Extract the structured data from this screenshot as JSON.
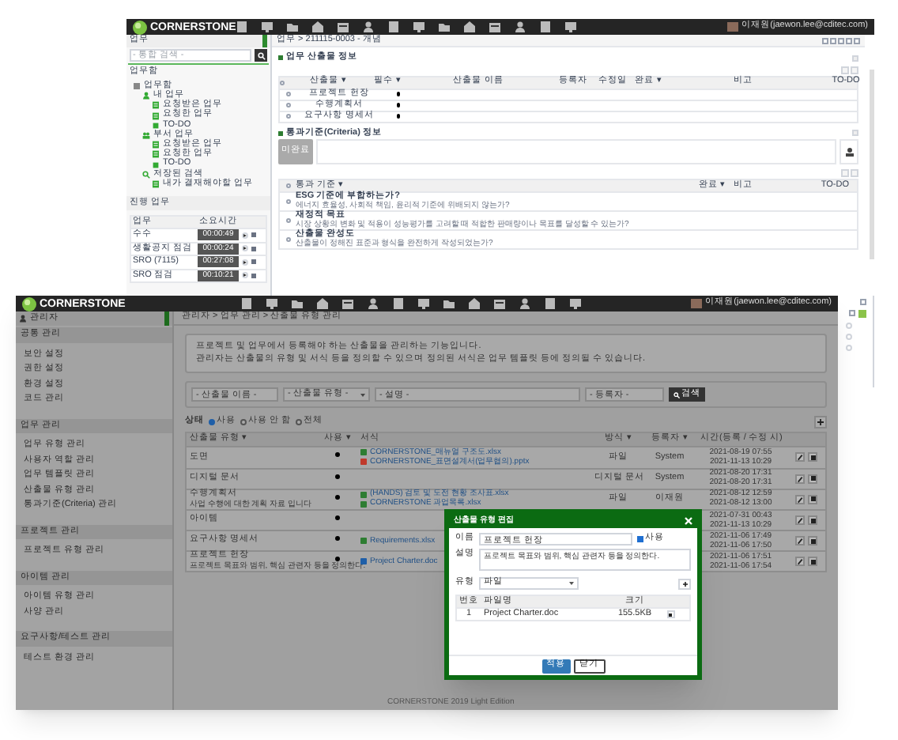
{
  "back_window": {
    "logo": "CORNERSTONE",
    "user": "이재원(jaewon.lee@cditec.com)",
    "sidebar": {
      "title": "업무",
      "search_placeholder": "- 통합 검색 -",
      "section_title": "업무함",
      "tree": [
        {
          "label": "업무함",
          "kind": "root",
          "children": [
            {
              "label": "내 업무",
              "kind": "person",
              "children": [
                {
                  "label": "요청받은 업무",
                  "kind": "list"
                },
                {
                  "label": "요청한 업무",
                  "kind": "list"
                },
                {
                  "label": "TO-DO",
                  "kind": "todo"
                }
              ]
            },
            {
              "label": "부서 업무",
              "kind": "group",
              "children": [
                {
                  "label": "요청받은 업무",
                  "kind": "list"
                },
                {
                  "label": "요청한 업무",
                  "kind": "list"
                },
                {
                  "label": "TO-DO",
                  "kind": "todo"
                }
              ]
            },
            {
              "label": "저장된 검색",
              "kind": "search",
              "children": [
                {
                  "label": "내가 결재해야할 업무",
                  "kind": "list"
                }
              ]
            }
          ]
        }
      ],
      "progress_title": "진행 업무",
      "progress_columns": [
        "업무",
        "소요시간"
      ],
      "progress_rows": [
        {
          "task": "수수",
          "time": "00:00:49"
        },
        {
          "task": "생활공지 점검",
          "time": "00:00:24"
        },
        {
          "task": "SRO (7115)",
          "time": "00:27:08"
        },
        {
          "task": "SRO 점검",
          "time": "00:10:21"
        }
      ]
    },
    "breadcrumb": "업무 > 211115-0003 - 개념",
    "deliverables": {
      "title": "업무 산출물 정보",
      "all_checked": false,
      "columns": [
        "산출물 ▾",
        "필수 ▾",
        "산출물 이름",
        "등록자",
        "수정일",
        "완료 ▾",
        "비고",
        "TO-DO"
      ],
      "rows": [
        {
          "type": "프로젝트 헌장",
          "required": true,
          "checked": false
        },
        {
          "type": "수행계획서",
          "required": true,
          "checked": false
        },
        {
          "type": "요구사항 명세서",
          "required": true,
          "checked": false
        }
      ]
    },
    "criteria": {
      "title": "통과기준(Criteria) 정보",
      "button": "미완료",
      "all_checked": false,
      "columns": [
        "통과 기준 ▾",
        "완료 ▾",
        "비고",
        "TO-DO"
      ],
      "rows": [
        {
          "checked": false,
          "title": "ESG 기준에 부합하는가?",
          "description": "에너지 효율성, 사회적 책임, 윤리적 기준에 위배되지 않는가?"
        },
        {
          "checked": false,
          "title": "재정적 목표",
          "description": "시장 상황의 변화 및 적용이 성능평가를 고려할 때 적합한 판매량이나 목표를 달성할 수 있는가?"
        },
        {
          "checked": false,
          "title": "산출물 완성도",
          "description": "산출물이 정해진 표준과 형식을 완전하게 작성되었는가?"
        }
      ]
    }
  },
  "front_window": {
    "logo": "CORNERSTONE",
    "user": "이재원(jaewon.lee@cditec.com)",
    "sidebar": {
      "title": "관리자",
      "groups": [
        {
          "title": "공통 관리",
          "items": [
            "보안 설정",
            "권한 설정",
            "환경 설정",
            "코드 관리"
          ]
        },
        {
          "title": "업무 관리",
          "items": [
            "업무 유형 관리",
            "사용자 역할 관리",
            "업무 템플릿 관리",
            "산출물 유형 관리",
            "통과기준(Criteria) 관리"
          ]
        },
        {
          "title": "프로젝트 관리",
          "items": [
            "프로젝트 유형 관리"
          ]
        },
        {
          "title": "아이템 관리",
          "items": [
            "아이템 유형 관리",
            "사양 관리"
          ]
        },
        {
          "title": "요구사항/테스트 관리",
          "items": [
            "테스트 환경 관리"
          ]
        }
      ]
    },
    "breadcrumb": "관리자 > 업무 관리 > 산출물 유형 관리",
    "info": [
      "프로젝트 및 업무에서 등록해야 하는 산출물을 관리하는 기능입니다.",
      "관리자는 산출물의 유형 및 서식 등을 정의할 수 있으며 정의된 서식은 업무 템플릿 등에 정의될 수 있습니다."
    ],
    "filters": {
      "name_placeholder": "- 산출물 이름 -",
      "type_placeholder": "- 산출물 유형 -",
      "description_placeholder": "- 설명 -",
      "registrant_placeholder": "- 등록자 -",
      "search_button": "검색"
    },
    "status": {
      "label": "상태",
      "options": [
        {
          "label": "사용",
          "selected": true
        },
        {
          "label": "사용 안 함",
          "selected": false
        },
        {
          "label": "전체",
          "selected": false
        }
      ]
    },
    "table": {
      "columns": [
        "산출물 유형 ▾",
        "사용 ▾",
        "서식",
        "방식 ▾",
        "등록자 ▾",
        "시간(등록 / 수정 시)"
      ],
      "rows": [
        {
          "type": "도면",
          "used": true,
          "files": [
            {
              "name": "CORNERSTONE_매뉴얼 구조도.xlsx",
              "kind": "xlsx"
            },
            {
              "name": "CORNERSTONE_표면설계서(업무협의).pptx",
              "kind": "pptx"
            }
          ],
          "method": "파일",
          "registrant": "System",
          "created": "2021-08-19 07:55",
          "modified": "2021-11-13 10:29"
        },
        {
          "type": "디지털 문서",
          "used": true,
          "files": [],
          "method": "디지털 문서",
          "registrant": "System",
          "created": "2021-08-20 17:31",
          "modified": "2021-08-20 17:31"
        },
        {
          "type": "수행계획서",
          "description": "사업 수행에 대한 계획 자료 입니다",
          "used": true,
          "files": [
            {
              "name": "(HANDS) 검토 및 도전 현황 조사표.xlsx",
              "kind": "xlsx"
            },
            {
              "name": "CORNERSTONE 과업목록.xlsx",
              "kind": "xlsx"
            }
          ],
          "method": "파일",
          "registrant": "이재원",
          "created": "2021-08-12 12:59",
          "modified": "2021-08-12 13:00"
        },
        {
          "type": "아이템",
          "used": true,
          "files": [],
          "created": "2021-07-31 00:43",
          "modified": "2021-11-13 10:29"
        },
        {
          "type": "요구사항 명세서",
          "used": true,
          "files": [
            {
              "name": "Requirements.xlsx",
              "kind": "xlsx"
            }
          ],
          "created": "2021-11-06 17:49",
          "modified": "2021-11-06 17:50"
        },
        {
          "type": "프로젝트 헌장",
          "description": "프로젝트 목표와 범위, 핵심 관련자 등을 정의한다.",
          "used": true,
          "files": [
            {
              "name": "Project Charter.doc",
              "kind": "doc"
            }
          ],
          "created": "2021-11-06 17:51",
          "modified": "2021-11-06 17:54"
        }
      ]
    },
    "footer": "CORNERSTONE 2019 Light Edition"
  },
  "dialog": {
    "title": "산출물 유형 편집",
    "name_label": "이름",
    "name_value": "프로젝트 헌장",
    "used_label": "사용",
    "used": true,
    "description_label": "설명",
    "description_value": "프로젝트 목표와 범위, 핵심 관련자 등을 정의한다.",
    "type_label": "유형",
    "type_value": "파일",
    "columns": [
      "번호",
      "파일명",
      "크기"
    ],
    "files": [
      {
        "number": "1",
        "name": "Project Charter.doc",
        "size": "155.5KB"
      }
    ],
    "buttons": [
      {
        "label": "적용",
        "kind": "primary"
      },
      {
        "label": "닫기",
        "kind": "secondary"
      }
    ]
  }
}
